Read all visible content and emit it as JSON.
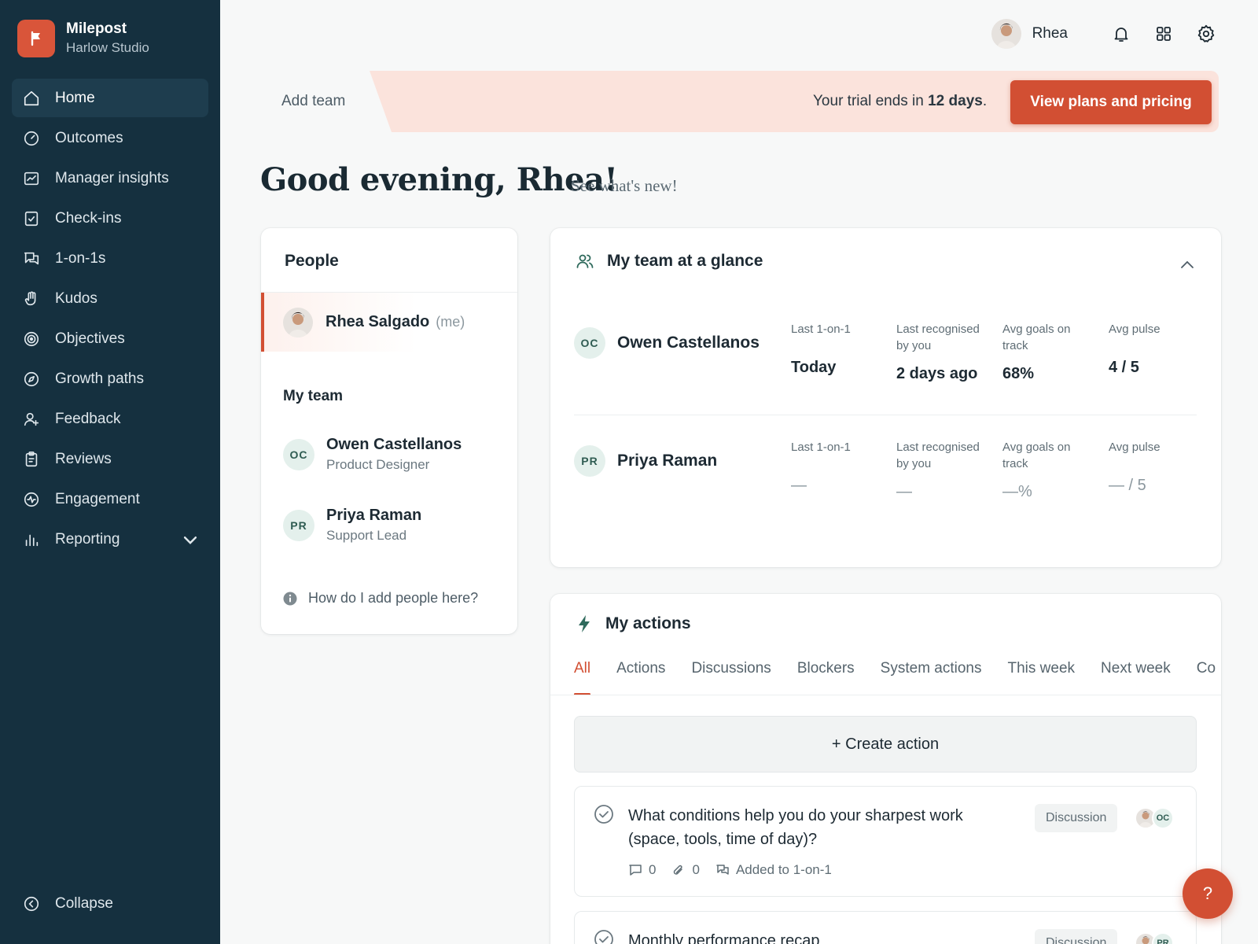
{
  "brand": {
    "name": "Milepost",
    "workspace": "Harlow Studio",
    "accent": "#d24f33",
    "sidebar_bg": "#15303f"
  },
  "sidebar": {
    "items": [
      {
        "label": "Home",
        "icon": "home-icon",
        "active": true
      },
      {
        "label": "Outcomes",
        "icon": "gauge-icon"
      },
      {
        "label": "Manager insights",
        "icon": "chart-icon"
      },
      {
        "label": "Check-ins",
        "icon": "checkin-icon"
      },
      {
        "label": "1-on-1s",
        "icon": "chat-icon"
      },
      {
        "label": "Kudos",
        "icon": "hand-icon"
      },
      {
        "label": "Objectives",
        "icon": "target-icon"
      },
      {
        "label": "Growth paths",
        "icon": "compass-icon"
      },
      {
        "label": "Feedback",
        "icon": "user-plus-icon"
      },
      {
        "label": "Reviews",
        "icon": "clipboard-icon"
      },
      {
        "label": "Engagement",
        "icon": "pulse-icon"
      },
      {
        "label": "Reporting",
        "icon": "bar-chart-icon"
      }
    ],
    "collapse_label": "Collapse"
  },
  "header": {
    "user_name": "Rhea"
  },
  "trial": {
    "add_team": "Add team",
    "text_before": "Your trial ends in ",
    "days": "12 days",
    "text_after": ".",
    "cta": "View plans and pricing"
  },
  "greeting": {
    "title": "Good evening, Rhea!",
    "whats_new": "See what's new!"
  },
  "people": {
    "title": "People",
    "me": {
      "name": "Rhea Salgado",
      "tag": "(me)"
    },
    "my_team_label": "My team",
    "team": [
      {
        "initials": "OC",
        "name": "Owen Castellanos",
        "role": "Product Designer"
      },
      {
        "initials": "PR",
        "name": "Priya Raman",
        "role": "Support Lead"
      }
    ],
    "help": "How do I add people here?"
  },
  "glance": {
    "title": "My team at a glance",
    "labels": {
      "last_1on1": "Last 1-on-1",
      "last_recognised": "Last recognised by you",
      "avg_goals": "Avg goals on track",
      "avg_pulse": "Avg pulse"
    },
    "rows": [
      {
        "initials": "OC",
        "name": "Owen Castellanos",
        "last_1on1": "Today",
        "last_recognised": "2 days ago",
        "avg_goals": "68%",
        "avg_pulse": "4 / 5"
      },
      {
        "initials": "PR",
        "name": "Priya Raman",
        "last_1on1": "—",
        "last_recognised": "—",
        "avg_goals": "—%",
        "avg_pulse": "— / 5"
      }
    ]
  },
  "actions": {
    "title": "My actions",
    "tabs": [
      "All",
      "Actions",
      "Discussions",
      "Blockers",
      "System actions",
      "This week",
      "Next week",
      "Co"
    ],
    "create_label": "+ Create action",
    "items": [
      {
        "text": "What conditions help you do your sharpest work (space, tools, time of day)?",
        "tag": "Discussion",
        "avatar_initials": "OC",
        "comments": "0",
        "attachments": "0",
        "added_to": "Added to 1-on-1"
      },
      {
        "text": "Monthly performance recap",
        "tag": "Discussion",
        "avatar_initials": "PR"
      }
    ]
  },
  "fab": {
    "label": "?"
  }
}
